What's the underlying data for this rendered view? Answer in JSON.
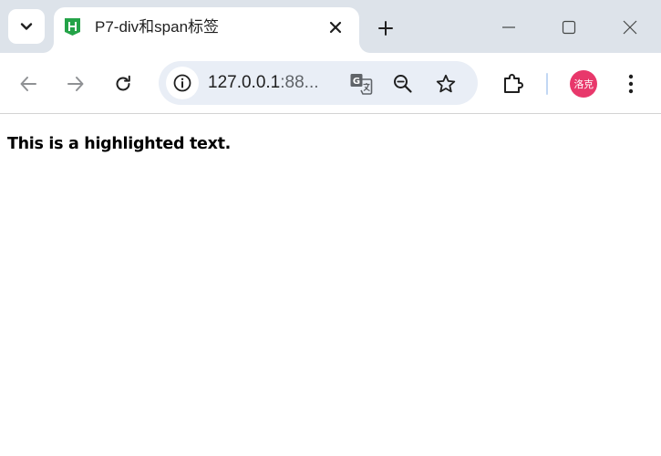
{
  "browser": {
    "tab": {
      "title": "P7-div和span标签",
      "favicon": "hbuilder-h-icon"
    },
    "address": {
      "host": "127.0.0.1",
      "rest": ":88..."
    },
    "profile": {
      "avatar_text": "洛克",
      "avatar_color": "#e8386b"
    },
    "icons": {
      "tab_search": "chevron-down-icon",
      "close_tab": "close-icon",
      "new_tab": "plus-icon",
      "minimize": "minimize-icon",
      "maximize": "maximize-icon",
      "close_window": "close-icon",
      "back": "back-arrow-icon",
      "forward": "forward-arrow-icon",
      "reload": "reload-icon",
      "site_info": "info-icon",
      "translate": "translate-icon",
      "zoom": "zoom-out-icon",
      "bookmark": "star-icon",
      "extensions": "puzzle-icon",
      "menu": "kebab-menu-icon"
    },
    "colors": {
      "tabstrip_bg": "#dde3ea",
      "omnibox_bg": "#e9eef6",
      "favicon_green": "#24a348"
    }
  },
  "page": {
    "highlighted_text": "This is a highlighted text."
  }
}
